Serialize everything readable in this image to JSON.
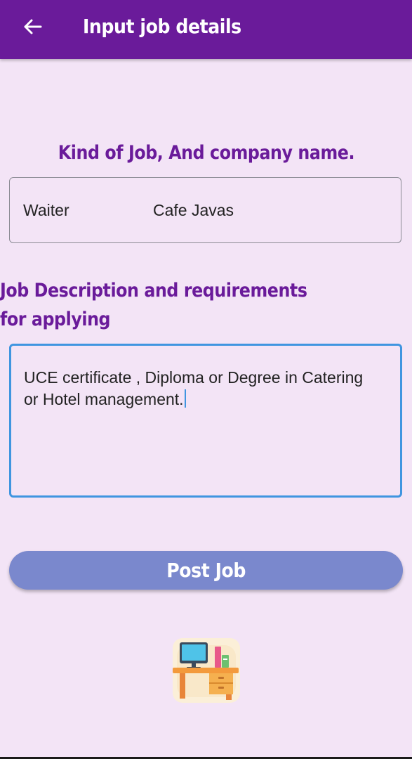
{
  "appbar": {
    "title": "Input job details",
    "back_icon": "arrow-left-icon"
  },
  "job_section": {
    "heading": "Kind of Job, And company name.",
    "job_kind": "Waiter",
    "company_name": "Cafe Javas"
  },
  "description_section": {
    "heading": "Job Description and requirements for applying",
    "text": "UCE certificate , Diploma or Degree in Catering or Hotel management."
  },
  "post_button": {
    "label": "Post Job"
  },
  "illustration": {
    "icon": "office-desk-icon"
  },
  "colors": {
    "appbar": "#6a1b9a",
    "background": "#f3e4f6",
    "heading": "#6a1b9a",
    "button": "#7a88cd",
    "focus_border": "#3f95e0"
  }
}
